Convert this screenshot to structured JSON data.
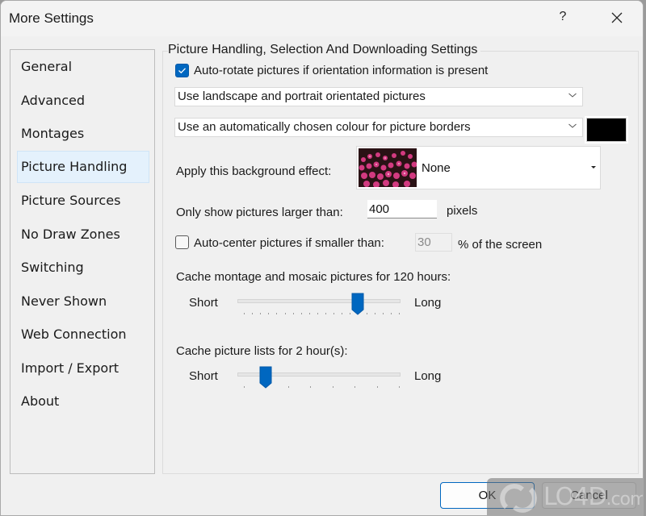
{
  "window": {
    "title": "More Settings",
    "help_label": "?",
    "close_icon": "close-icon"
  },
  "sidebar": {
    "selected": "Picture Handling",
    "items": [
      {
        "label": "General"
      },
      {
        "label": "Advanced"
      },
      {
        "label": "Montages"
      },
      {
        "label": "Picture Handling"
      },
      {
        "label": "Picture Sources"
      },
      {
        "label": "No Draw Zones"
      },
      {
        "label": "Switching"
      },
      {
        "label": "Never Shown"
      },
      {
        "label": "Web Connection"
      },
      {
        "label": "Import / Export"
      },
      {
        "label": "About"
      }
    ]
  },
  "panel": {
    "group_title": "Picture Handling, Selection And Downloading Settings",
    "auto_rotate": {
      "label": "Auto-rotate pictures if orientation information is present",
      "checked": true
    },
    "orientation_combo": {
      "value": "Use landscape and portrait orientated pictures"
    },
    "border_combo": {
      "value": "Use an automatically chosen colour for picture borders"
    },
    "border_color": "#000000",
    "background_effect": {
      "label": "Apply this background effect:",
      "value": "None",
      "thumbnail": "pink-flowers-image"
    },
    "min_size": {
      "label": "Only show pictures larger than:",
      "value": "400",
      "unit": "pixels"
    },
    "auto_center": {
      "label": "Auto-center pictures if smaller than:",
      "checked": false,
      "value": "30",
      "unit": "% of the screen"
    },
    "cache_montage": {
      "label": "Cache montage and mosaic pictures for 120 hours:",
      "min_label": "Short",
      "max_label": "Long",
      "tick_count": 20,
      "position": 14
    },
    "cache_lists": {
      "label": "Cache picture lists for 2 hour(s):",
      "min_label": "Short",
      "max_label": "Long",
      "tick_count": 8,
      "position": 1
    }
  },
  "buttons": {
    "ok": "OK",
    "cancel": "Cancel"
  },
  "colors": {
    "accent": "#0067c0",
    "selected_bg": "#e4f1fc"
  },
  "watermark": {
    "text": "LO4D",
    "suffix": ".com"
  }
}
